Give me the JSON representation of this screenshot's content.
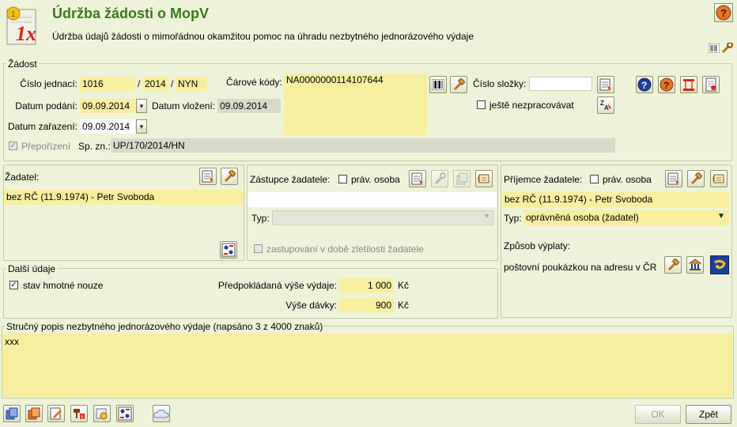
{
  "header": {
    "title": "Údržba žádosti o MopV",
    "subtitle": "Údržba údajů žádosti o mimořádnou okamžitou pomoc na úhradu nezbytného jednorázového výdaje",
    "logo_text": "1x"
  },
  "zadost": {
    "legend": "Žádost",
    "cislo_jednaci_label": "Číslo jednací:",
    "cj_number": "1016",
    "cj_sep1": "/",
    "cj_year": "2014",
    "cj_sep2": "/",
    "cj_suffix": "NYN",
    "carove_kody_label": "Čárové kódy:",
    "carovy_kod": "NA0000000114107644",
    "cislo_slozky_label": "Číslo složky:",
    "cislo_slozky_value": "",
    "nezpracovavat_label": "ještě nezpracovávat",
    "datum_podani_label": "Datum podání:",
    "datum_podani": "09.09.2014",
    "datum_vlozeni_label": "Datum vložení:",
    "datum_vlozeni": "09.09.2014",
    "datum_zarazeni_label": "Datum zařazení:",
    "datum_zarazeni": "09.09.2014",
    "prepozizeni_label": "Přepořízení",
    "sp_zn_label": "Sp. zn.:",
    "sp_zn": "UP/170/2014/HN"
  },
  "zadatel": {
    "label": "Žadatel:",
    "value": "bez RČ (11.9.1974) - Petr Svoboda"
  },
  "zastupce": {
    "label": "Zástupce žadatele:",
    "prav_osoba_label": "práv. osoba",
    "value": "",
    "typ_label": "Typ:",
    "typ_value": "",
    "zastupovani_label": "zastupování v době zletilosti žadatele"
  },
  "prijemce": {
    "label": "Příjemce žadatele:",
    "prav_osoba_label": "práv. osoba",
    "value": "bez RČ (11.9.1974) - Petr Svoboda",
    "typ_label": "Typ:",
    "typ_value": "oprávněná osoba (žadatel)",
    "zpusob_label": "Způsob výplaty:",
    "zpusob_value": "poštovní poukázkou na adresu v ČR"
  },
  "dalsi": {
    "legend": "Další údaje",
    "hmotna_nouze_label": "stav hmotné nouze",
    "predpokladana_label": "Předpokládaná výše výdaje:",
    "predpokladana_value": "1 000",
    "predpokladana_unit": "Kč",
    "vyse_davky_label": "Výše dávky:",
    "vyse_davky_value": "900",
    "vyse_davky_unit": "Kč"
  },
  "popis": {
    "legend": "Stručný popis nezbytného jednorázového výdaje (napsáno 3 z 4000 znaků)",
    "value": "xxx"
  },
  "footer": {
    "ok_label": "OK",
    "zpet_label": "Zpět"
  },
  "colors": {
    "title": "#3a7a1e",
    "background": "#eef2d8",
    "field": "#f7ef9f"
  }
}
